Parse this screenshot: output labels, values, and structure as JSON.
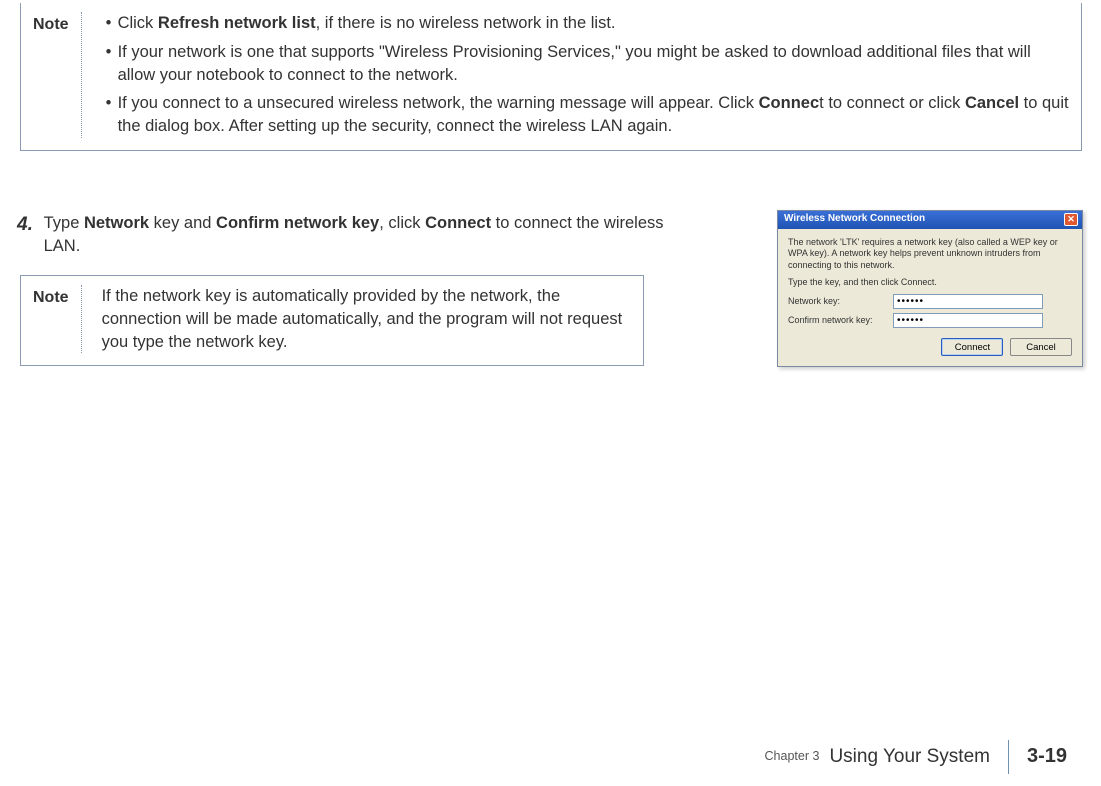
{
  "note1": {
    "label": "Note",
    "items": [
      {
        "pre": "Click ",
        "bold1": "Refresh network list",
        "post1": ", if there is no wireless network in the list."
      },
      {
        "line1": "If your network is one that supports \"Wireless Provisioning Services,\" you might be asked to download additional files that will allow your notebook to connect to the network."
      },
      {
        "pre": "If you connect to a unsecured wireless network, the warning message will appear. Click ",
        "bold1": "Connec",
        "mid1": "t to connect or click ",
        "bold2": "Cancel",
        "post1": " to quit the dialog box. After setting up the security, connect the wireless LAN again."
      }
    ]
  },
  "step4": {
    "num": "4.",
    "pre": "Type ",
    "b1": "Network",
    "m1": " key and ",
    "b2": "Confirm network key",
    "m2": ", click ",
    "b3": "Connect",
    "post": " to connect the wireless LAN."
  },
  "note2": {
    "label": "Note",
    "text": "If the network key is automatically provided by the network, the connection will be made automatically, and the program will not request you type the network key."
  },
  "dialog": {
    "title": "Wireless Network Connection",
    "desc": "The network 'LTK' requires a network key (also called a WEP key or WPA key). A network key helps prevent unknown intruders from connecting to this network.",
    "instruct": "Type the key, and then click Connect.",
    "label_key": "Network key:",
    "label_confirm": "Confirm network key:",
    "value_key": "••••••",
    "value_confirm": "••••••",
    "btn_connect": "Connect",
    "btn_cancel": "Cancel"
  },
  "footer": {
    "chapter": "Chapter 3",
    "title": "Using Your System",
    "page": "3-19"
  }
}
